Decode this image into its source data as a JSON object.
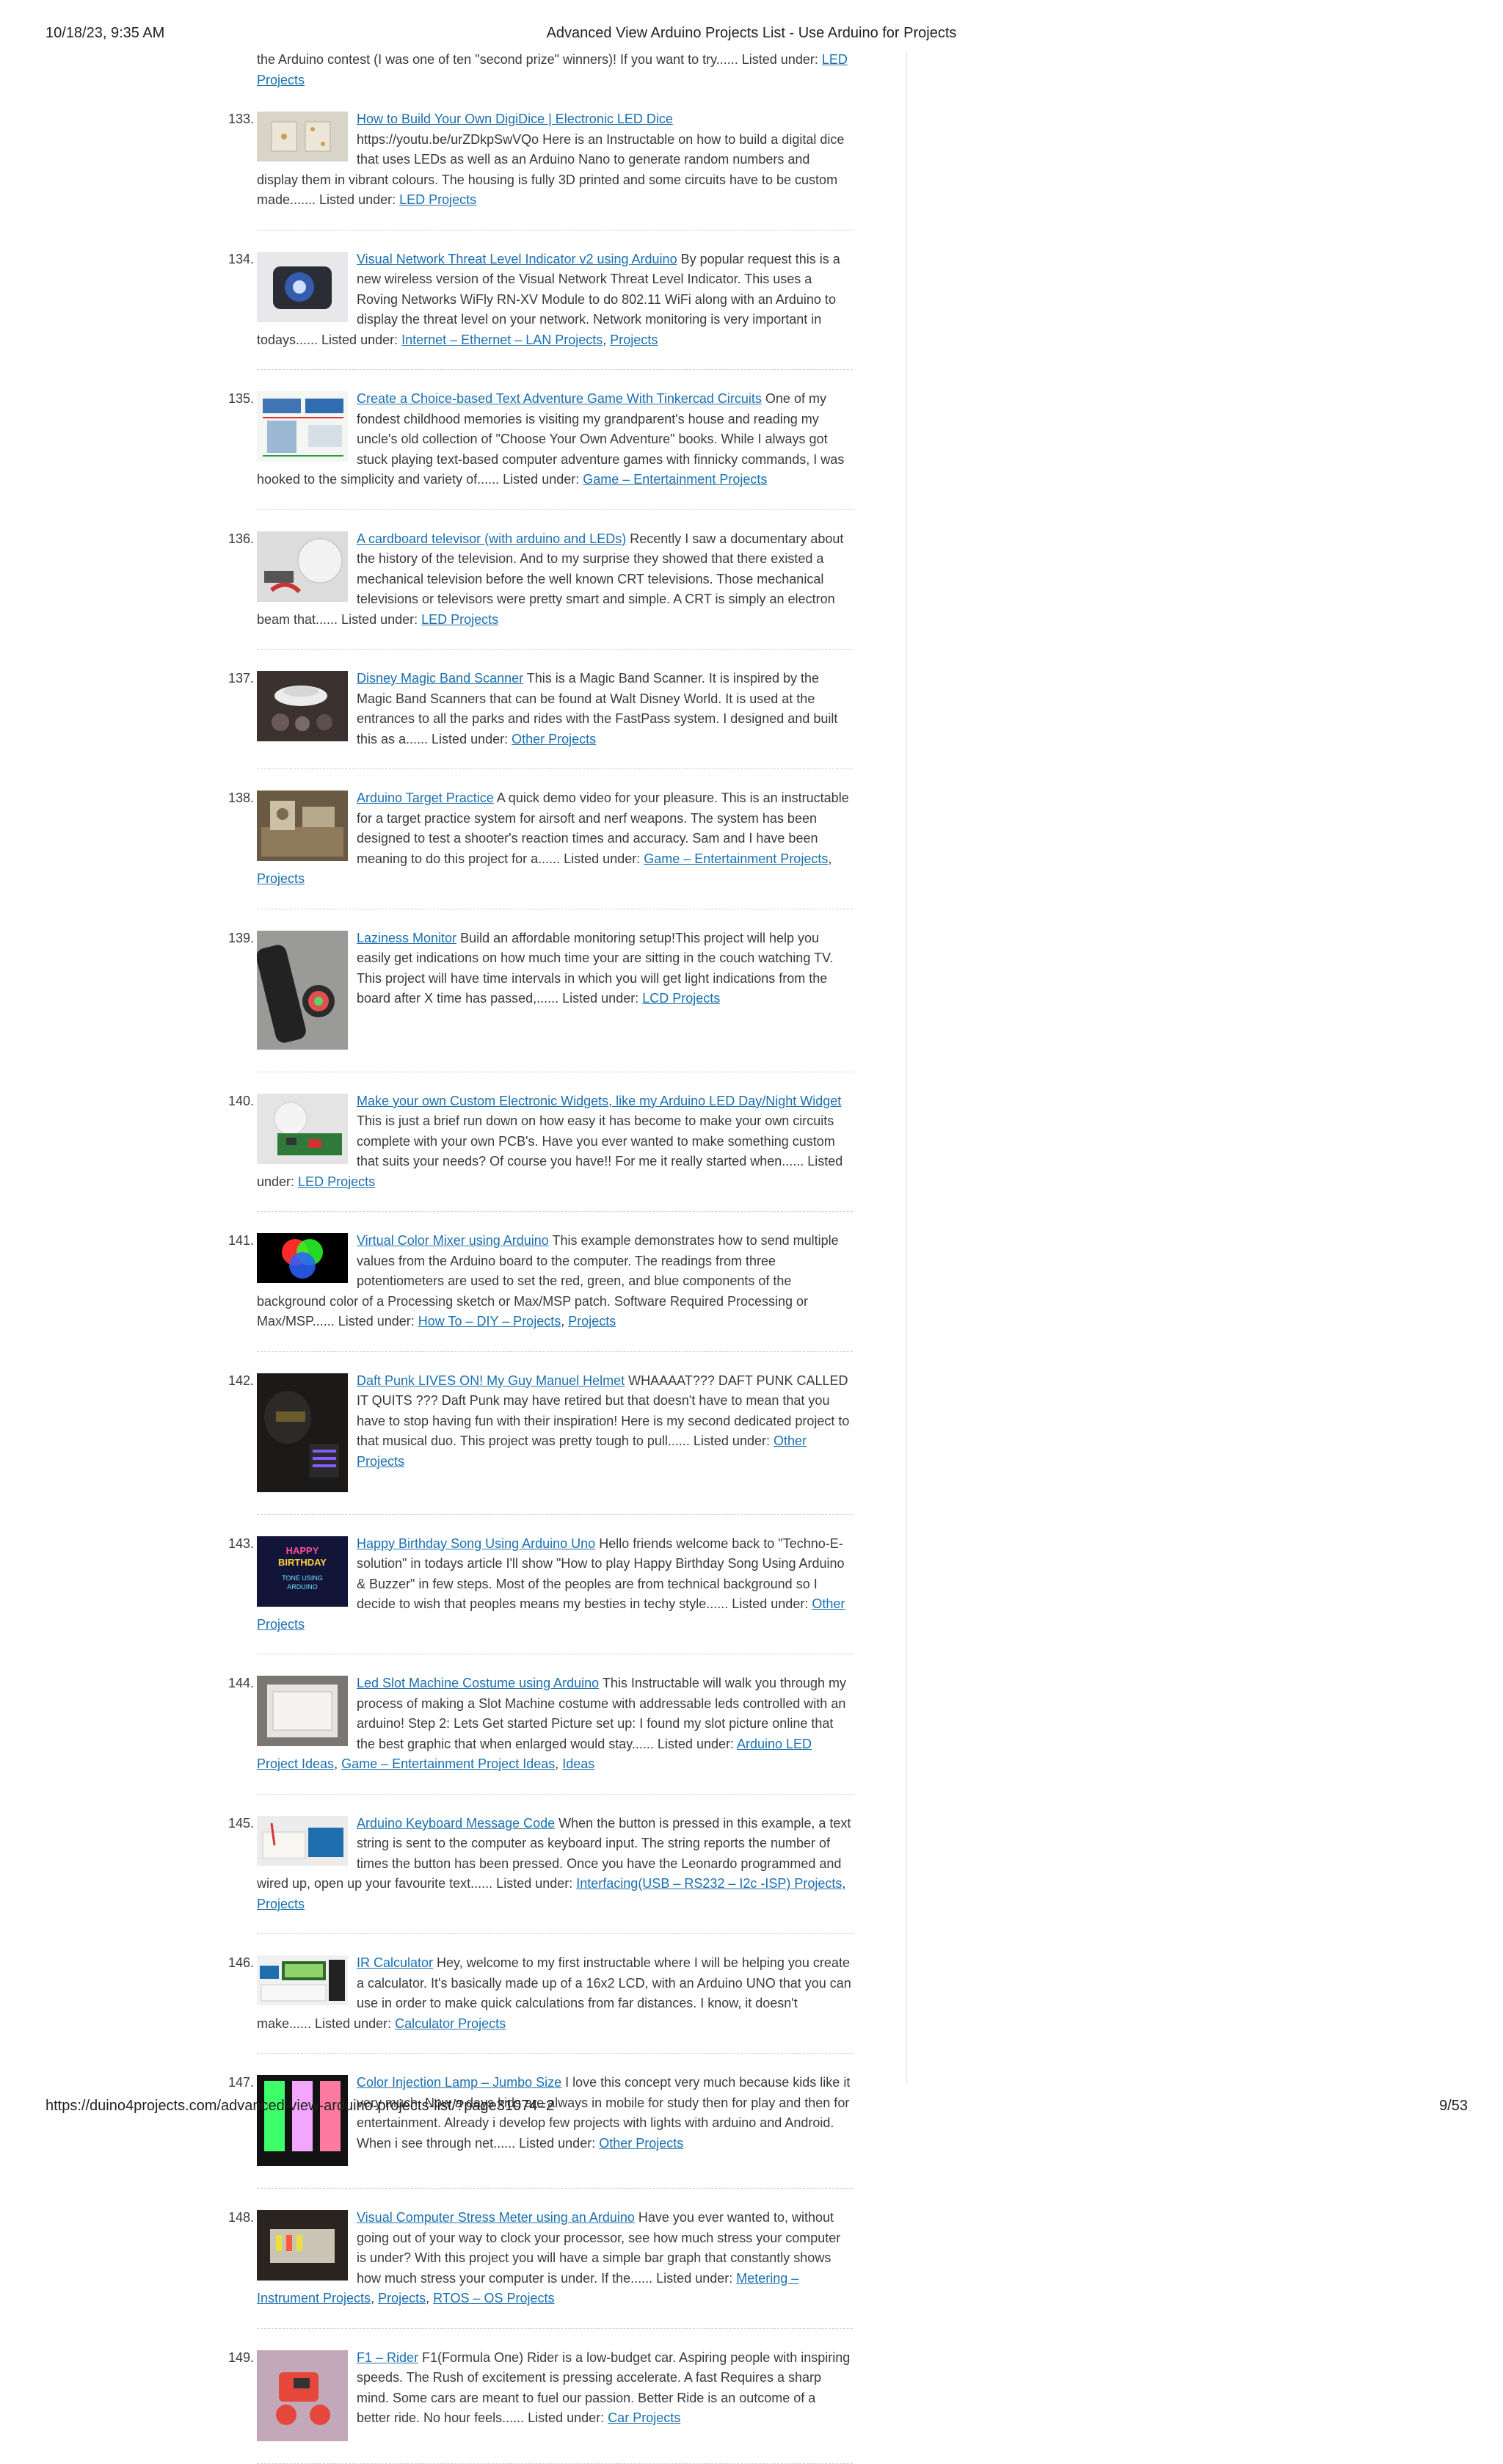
{
  "print_header": {
    "datetime": "10/18/23, 9:35 AM",
    "title": "Advanced View Arduino Projects List - Use Arduino for Projects"
  },
  "print_footer": {
    "url": "https://duino4projects.com/advanced-view-arduino-projects-list/?page31074=2",
    "page": "9/53"
  },
  "lead": {
    "text": "the Arduino contest (I was one of ten \"second prize\" winners)! If you want to try...... Listed under: ",
    "link": "LED Projects"
  },
  "projects": [
    {
      "num": "133.",
      "title": "How to Build Your Own DigiDice | Electronic LED Dice",
      "desc": " https://youtu.be/urZDkpSwVQo Here is an Instructable on how to build a digital dice that uses LEDs as well as an Arduino Nano to generate random numbers and display them in vibrant colours. The housing is fully 3D printed and some circuits have to be custom made....... Listed under: ",
      "categories": [
        "LED Projects"
      ],
      "thumb_icon": "led-dice-thumbnail"
    },
    {
      "num": "134.",
      "title": "Visual Network Threat Level Indicator v2 using Arduino",
      "desc": " By popular request this is a new wireless version of the Visual Network Threat Level Indicator. This uses a Roving Networks WiFly RN-XV Module to do 802.11 WiFi along with an Arduino to display the threat level on your network. Network monitoring is very important in todays...... Listed under: ",
      "categories": [
        "Internet – Ethernet – LAN Projects",
        "Projects"
      ],
      "thumb_icon": "blue-light-thumbnail"
    },
    {
      "num": "135.",
      "title": "Create a Choice-based Text Adventure Game With Tinkercad Circuits",
      "desc": " One of my fondest childhood memories is visiting my grandparent's house and reading my uncle's old collection of \"Choose Your Own Adventure\" books. While I always got stuck playing text-based computer adventure games with finnicky commands, I was hooked to the simplicity and variety of...... Listed under: ",
      "categories": [
        "Game – Entertainment Projects"
      ],
      "thumb_icon": "circuit-diagram-thumbnail"
    },
    {
      "num": "136.",
      "title": "A cardboard televisor (with arduino and LEDs)",
      "desc": " Recently I saw a documentary about the history of the television.  And to my surprise they showed that there existed a mechanical television before the well known CRT televisions. Those mechanical televisions or televisors were pretty smart and simple. A CRT is simply an electron beam that...... Listed under: ",
      "categories": [
        "LED Projects"
      ],
      "thumb_icon": "cardboard-disc-thumbnail"
    },
    {
      "num": "137.",
      "title": "Disney Magic Band Scanner",
      "desc": " This is a Magic Band Scanner. It is inspired by the Magic Band Scanners that can be found at Walt Disney World. It is used at the entrances to all the parks and rides with the FastPass system. I designed and built this as a...... Listed under: ",
      "categories": [
        "Other Projects"
      ],
      "thumb_icon": "scanner-thumbnail"
    },
    {
      "num": "138.",
      "title": "Arduino Target Practice",
      "desc": " A quick demo video for your pleasure. This is an instructable for a target practice system for airsoft and nerf weapons. The system has been designed to test a shooter's reaction times and accuracy. Sam and I have been meaning to do this project for a...... Listed under: ",
      "categories": [
        "Game – Entertainment Projects",
        "Projects"
      ],
      "thumb_icon": "target-board-thumbnail"
    },
    {
      "num": "139.",
      "title": "Laziness Monitor",
      "desc": " Build an affordable monitoring setup!This project will help you easily get indications on how much time your are sitting in the couch watching TV. This project will have time intervals in which you will get light indications from the board after X time has passed,...... Listed under: ",
      "categories": [
        "LCD Projects"
      ],
      "thumb_icon": "remote-control-thumbnail"
    },
    {
      "num": "140.",
      "title": "Make your own Custom Electronic Widgets, like my Arduino LED Day/Night Widget",
      "desc": " This is just a brief run down on how easy it has become to make your own circuits complete with your own PCB's.  Have you ever wanted to make something custom that suits your needs? Of course you have!! For me it really started when...... Listed under: ",
      "categories": [
        "LED Projects"
      ],
      "thumb_icon": "widget-board-thumbnail"
    },
    {
      "num": "141.",
      "title": "Virtual Color Mixer using Arduino",
      "desc": " This example demonstrates how to send multiple values from the Arduino board to the computer. The readings from three potentiometers are used to set the red, green, and blue components of the background color of a Processing sketch or Max/MSP patch. Software Required Processing or Max/MSP...... Listed under: ",
      "categories": [
        "How To – DIY – Projects",
        "Projects"
      ],
      "thumb_icon": "rgb-circles-thumbnail"
    },
    {
      "num": "142.",
      "title": "Daft Punk LIVES ON! My Guy Manuel Helmet",
      "desc": " WHAAAAT??? DAFT PUNK CALLED IT QUITS ??? Daft Punk may have retired but that doesn't have to mean that you have to stop having fun with their inspiration! Here is my second dedicated project to that musical duo. This project was pretty tough to pull...... Listed under: ",
      "categories": [
        "Other Projects"
      ],
      "thumb_icon": "helmet-thumbnail"
    },
    {
      "num": "143.",
      "title": "Happy Birthday Song Using Arduino Uno",
      "desc": " Hello friends welcome back to \"Techno-E-solution\" in todays article I'll show \"How to play Happy Birthday Song Using Arduino & Buzzer\" in few steps. Most of the peoples are from technical background so I decide to wish that peoples means my besties in techy style...... Listed under: ",
      "categories": [
        "Other Projects"
      ],
      "thumb_icon": "birthday-banner-thumbnail",
      "thumb_text": [
        "HAPPY",
        "BIRTHDAY",
        "TONE USING",
        "ARDUINO"
      ]
    },
    {
      "num": "144.",
      "title": "Led Slot Machine Costume using Arduino",
      "desc": " This Instructable will walk you through my process of making a Slot Machine costume with addressable leds controlled with an arduino!   Step 2: Lets Get started Picture set up: I found my slot picture online that the best graphic that when enlarged would stay...... Listed under: ",
      "categories": [
        "Arduino LED Project Ideas",
        "Game – Entertainment Project Ideas",
        "Ideas"
      ],
      "thumb_icon": "slot-machine-thumbnail"
    },
    {
      "num": "145.",
      "title": "Arduino Keyboard Message Code",
      "desc": " When the button is pressed in this example, a text string is sent to the computer as keyboard input. The string reports the number of times the button has been pressed. Once you have the Leonardo programmed and wired up, open up your favourite text...... Listed under: ",
      "categories": [
        "Interfacing(USB – RS232 – I2c -ISP) Projects",
        "Projects"
      ],
      "thumb_icon": "breadboard-thumbnail"
    },
    {
      "num": "146.",
      "title": "IR Calculator",
      "desc": " Hey, welcome to my first instructable where I will be helping you create a calculator. It's basically made up of a 16x2 LCD, with an Arduino UNO that you can use in order to make quick calculations from far distances. I know, it doesn't make...... Listed under: ",
      "categories": [
        "Calculator Projects"
      ],
      "thumb_icon": "lcd-keypad-thumbnail"
    },
    {
      "num": "147.",
      "title": "Color Injection Lamp – Jumbo Size",
      "desc": " I love this concept very much because kids like it very much. Now a days kids are always in mobile for study then for play and then for entertainment. Already i develop few projects with lights with arduino and Android. When i see through net...... Listed under: ",
      "categories": [
        "Other Projects"
      ],
      "thumb_icon": "color-lamps-thumbnail"
    },
    {
      "num": "148.",
      "title": "Visual Computer Stress Meter using an Arduino",
      "desc": " Have you ever wanted to, without going out of your way to clock your processor, see how much stress your computer is under? With this project you will have a simple bar graph that constantly shows how much stress your computer is under. If the...... Listed under: ",
      "categories": [
        "Metering – Instrument Projects",
        "Projects",
        "RTOS – OS Projects"
      ],
      "thumb_icon": "stress-meter-thumbnail"
    },
    {
      "num": "149.",
      "title": "F1 – Rider",
      "desc": " F1(Formula One) Rider is a low-budget car. Aspiring people with inspiring speeds. The Rush of excitement is pressing accelerate. A fast Requires a sharp mind. Some cars are meant to fuel our passion. Better Ride is an outcome of a better ride. No hour feels...... Listed under: ",
      "categories": [
        "Car Projects"
      ],
      "thumb_icon": "robot-car-thumbnail"
    }
  ]
}
